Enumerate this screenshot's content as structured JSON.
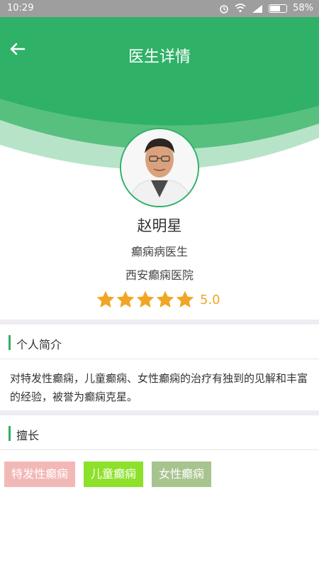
{
  "status_bar": {
    "time": "10:29",
    "battery": "58%"
  },
  "header": {
    "title": "医生详情"
  },
  "doctor": {
    "name": "赵明星",
    "title": "癫痫病医生",
    "hospital": "西安癫痫医院",
    "rating": 5,
    "rating_label": "5.0"
  },
  "intro_section": {
    "label": "个人简介",
    "text": "对特发性癫痫，儿童癫痫、女性癫痫的治疗有独到的见解和丰富的经验，被誉为癫痫克星。"
  },
  "specialty_section": {
    "label": "擅长",
    "tags": [
      {
        "label": "特发性癫痫",
        "color": "#f2b8b6"
      },
      {
        "label": "儿童癫痫",
        "color": "#8ee12a"
      },
      {
        "label": "女性癫痫",
        "color": "#a7c48f"
      }
    ]
  },
  "colors": {
    "accent": "#2fb167",
    "star": "#f0a624"
  }
}
